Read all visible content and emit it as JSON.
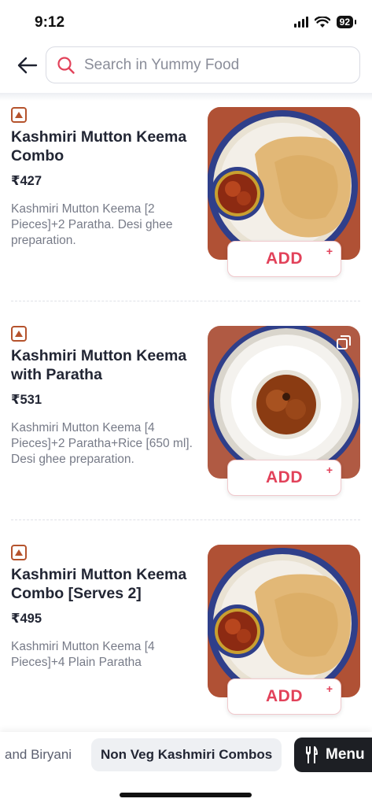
{
  "status": {
    "time": "9:12",
    "battery": "92"
  },
  "search": {
    "placeholder": "Search in Yummy Food"
  },
  "items": [
    {
      "name": "Kashmiri Mutton Keema Combo",
      "price": "₹427",
      "description": "Kashmiri Mutton Keema [2 Pieces]+2 Paratha. Desi ghee preparation.",
      "image": "paratha-keema",
      "add_label": "ADD",
      "add_plus": "+"
    },
    {
      "name": "Kashmiri Mutton Keema with Paratha",
      "price": "₹531",
      "description": "Kashmiri Mutton Keema [4 Pieces]+2 Paratha+Rice [650 ml]. Desi ghee preparation.",
      "image": "rice-keema",
      "add_label": "ADD",
      "add_plus": "+"
    },
    {
      "name": "Kashmiri Mutton Keema Combo [Serves 2]",
      "price": "₹495",
      "description": "Kashmiri Mutton Keema [4 Pieces]+4 Plain Paratha",
      "image": "paratha-keema",
      "add_label": "ADD",
      "add_plus": "+"
    }
  ],
  "categories": [
    {
      "label": "and Biryani",
      "active": false
    },
    {
      "label": "Non Veg Kashmiri Combos",
      "active": true
    }
  ],
  "menu_button": {
    "label": "Menu"
  },
  "colors": {
    "accent": "#e2425a",
    "veg_mark": "#b5532d",
    "menu_bg": "#1d1f24"
  }
}
